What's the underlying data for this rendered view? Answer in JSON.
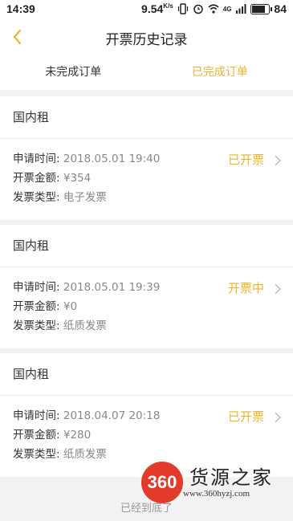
{
  "status_bar": {
    "time": "14:39",
    "network_speed": "9.54",
    "network_unit": "K/s",
    "battery_percent": "84",
    "battery_level": 0.84,
    "signal_label": "4G"
  },
  "header": {
    "title": "开票历史记录",
    "back_icon": "chevron-left-icon"
  },
  "tabs": [
    {
      "label": "未完成订单",
      "active": false
    },
    {
      "label": "已完成订单",
      "active": true
    }
  ],
  "orders": [
    {
      "category": "国内租",
      "apply_time_label": "申请时间:",
      "apply_time": "2018.05.01 19:40",
      "amount_label": "开票金额:",
      "amount": "¥354",
      "type_label": "发票类型:",
      "type": "电子发票",
      "status": "已开票"
    },
    {
      "category": "国内租",
      "apply_time_label": "申请时间:",
      "apply_time": "2018.05.01 19:39",
      "amount_label": "开票金额:",
      "amount": "¥0",
      "type_label": "发票类型:",
      "type": "纸质发票",
      "status": "开票中"
    },
    {
      "category": "国内租",
      "apply_time_label": "申请时间:",
      "apply_time": "2018.04.07 20:18",
      "amount_label": "开票金额:",
      "amount": "¥280",
      "type_label": "发票类型:",
      "type": "纸质发票",
      "status": "已开票"
    }
  ],
  "footer": {
    "text": "已经到底了"
  },
  "watermark": {
    "badge": "360",
    "name": "货源之家",
    "url": "www.360hyzj.com"
  },
  "colors": {
    "accent": "#f0b22b",
    "background": "#f2f2f2",
    "watermark_red": "#e23a2b"
  }
}
